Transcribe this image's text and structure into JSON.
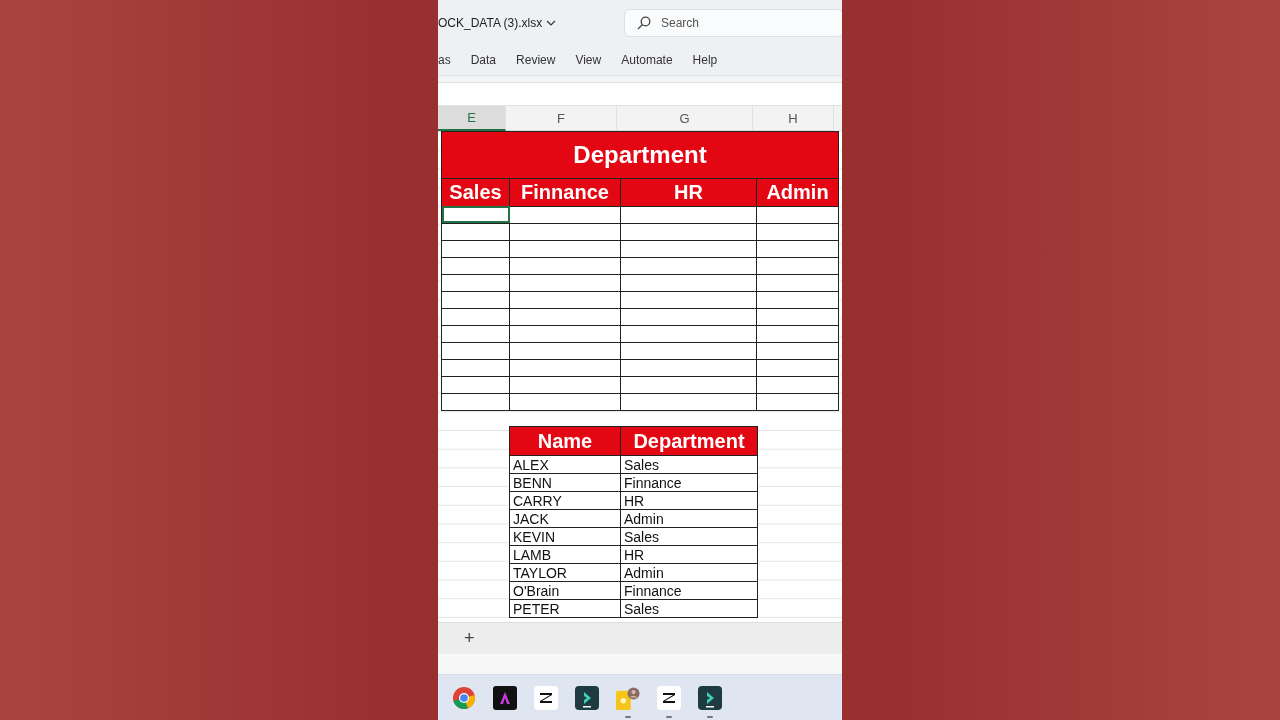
{
  "window": {
    "file_name": "OCK_DATA (3).xlsx",
    "search": {
      "placeholder": "Search"
    }
  },
  "ribbon_tabs": [
    "as",
    "Data",
    "Review",
    "View",
    "Automate",
    "Help"
  ],
  "columns": [
    {
      "label": "E",
      "selected": true
    },
    {
      "label": "F",
      "selected": false
    },
    {
      "label": "G",
      "selected": false
    },
    {
      "label": "H",
      "selected": false
    }
  ],
  "department_table": {
    "title": "Department",
    "headers": [
      "Sales",
      "Finnance",
      "HR",
      "Admin"
    ]
  },
  "name_table": {
    "headers": [
      "Name",
      "Department"
    ],
    "rows": [
      [
        "ALEX",
        "Sales"
      ],
      [
        "BENN",
        "Finnance"
      ],
      [
        "CARRY",
        "HR"
      ],
      [
        "JACK",
        "Admin"
      ],
      [
        "KEVIN",
        "Sales"
      ],
      [
        "LAMB",
        "HR"
      ],
      [
        "TAYLOR",
        "Admin"
      ],
      [
        "O'Brain",
        "Finnance"
      ],
      [
        "PETER",
        "Sales"
      ]
    ]
  },
  "sheet_bar": {
    "add_button": "+"
  },
  "taskbar": {
    "apps": [
      {
        "kind": "browser",
        "running": false
      },
      {
        "kind": "design",
        "running": false
      },
      {
        "kind": "editor",
        "running": false
      },
      {
        "kind": "arrow",
        "running": false
      },
      {
        "kind": "notes",
        "running": true
      },
      {
        "kind": "editor",
        "running": true
      },
      {
        "kind": "arrow",
        "running": true
      }
    ]
  }
}
